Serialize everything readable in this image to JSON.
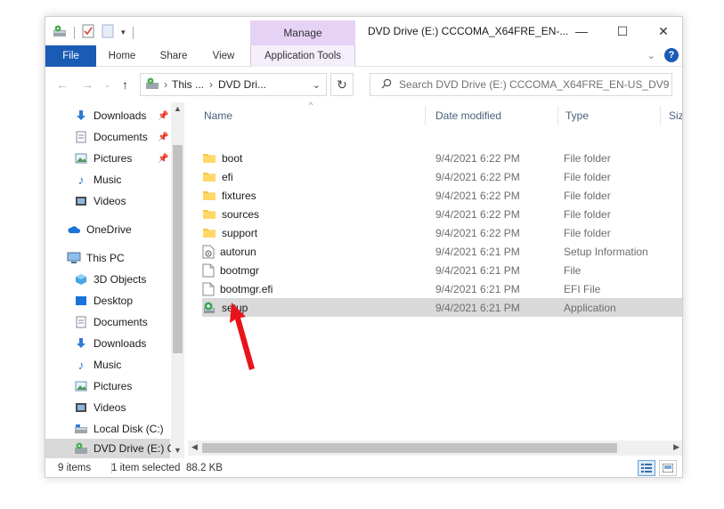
{
  "window": {
    "title": "DVD Drive (E:) CCCOMA_X64FRE_EN-...",
    "contextual_tab": "Manage",
    "controls": {
      "minimize": "—",
      "maximize": "☐",
      "close": "✕"
    }
  },
  "ribbon": {
    "tabs": [
      {
        "label": "File"
      },
      {
        "label": "Home"
      },
      {
        "label": "Share"
      },
      {
        "label": "View"
      },
      {
        "label": "Application Tools"
      }
    ],
    "expand_icon": "chevron-down-icon",
    "help_label": "?"
  },
  "address": {
    "path": [
      "This ...",
      "DVD Dri..."
    ],
    "search_placeholder": "Search DVD Drive (E:) CCCOMA_X64FRE_EN-US_DV9"
  },
  "nav": {
    "quick_access": [
      {
        "label": "Downloads",
        "icon": "download-icon",
        "pinned": true
      },
      {
        "label": "Documents",
        "icon": "documents-icon",
        "pinned": true
      },
      {
        "label": "Pictures",
        "icon": "pictures-icon",
        "pinned": true
      },
      {
        "label": "Music",
        "icon": "music-icon",
        "pinned": false
      },
      {
        "label": "Videos",
        "icon": "videos-icon",
        "pinned": false
      }
    ],
    "onedrive": "OneDrive",
    "this_pc": "This PC",
    "pc_items": [
      {
        "label": "3D Objects",
        "icon": "3d-objects-icon"
      },
      {
        "label": "Desktop",
        "icon": "desktop-icon"
      },
      {
        "label": "Documents",
        "icon": "documents-icon"
      },
      {
        "label": "Downloads",
        "icon": "download-icon"
      },
      {
        "label": "Music",
        "icon": "music-icon"
      },
      {
        "label": "Pictures",
        "icon": "pictures-icon"
      },
      {
        "label": "Videos",
        "icon": "videos-icon"
      },
      {
        "label": "Local Disk (C:)",
        "icon": "local-disk-icon"
      },
      {
        "label": "DVD Drive (E:) C(",
        "icon": "dvd-drive-icon",
        "selected": true
      }
    ]
  },
  "columns": {
    "name": "Name",
    "date": "Date modified",
    "type": "Type",
    "size": "Siz"
  },
  "files": [
    {
      "name": "boot",
      "date": "9/4/2021 6:22 PM",
      "type": "File folder",
      "icon": "folder-icon"
    },
    {
      "name": "efi",
      "date": "9/4/2021 6:22 PM",
      "type": "File folder",
      "icon": "folder-icon"
    },
    {
      "name": "fixtures",
      "date": "9/4/2021 6:22 PM",
      "type": "File folder",
      "icon": "folder-icon"
    },
    {
      "name": "sources",
      "date": "9/4/2021 6:22 PM",
      "type": "File folder",
      "icon": "folder-icon"
    },
    {
      "name": "support",
      "date": "9/4/2021 6:22 PM",
      "type": "File folder",
      "icon": "folder-icon"
    },
    {
      "name": "autorun",
      "date": "9/4/2021 6:21 PM",
      "type": "Setup Information",
      "icon": "setup-info-icon"
    },
    {
      "name": "bootmgr",
      "date": "9/4/2021 6:21 PM",
      "type": "File",
      "icon": "file-icon"
    },
    {
      "name": "bootmgr.efi",
      "date": "9/4/2021 6:21 PM",
      "type": "EFI File",
      "icon": "file-icon"
    },
    {
      "name": "setup",
      "date": "9/4/2021 6:21 PM",
      "type": "Application",
      "icon": "setup-app-icon",
      "selected": true
    }
  ],
  "status": {
    "item_count": "9 items",
    "selection": "1 item selected",
    "size": "88.2 KB"
  },
  "colors": {
    "accent": "#1a5bb5",
    "manage": "#e5d2f5",
    "selection": "#d9d9d9",
    "arrow": "#e8141b",
    "folder": "#f5c447"
  }
}
